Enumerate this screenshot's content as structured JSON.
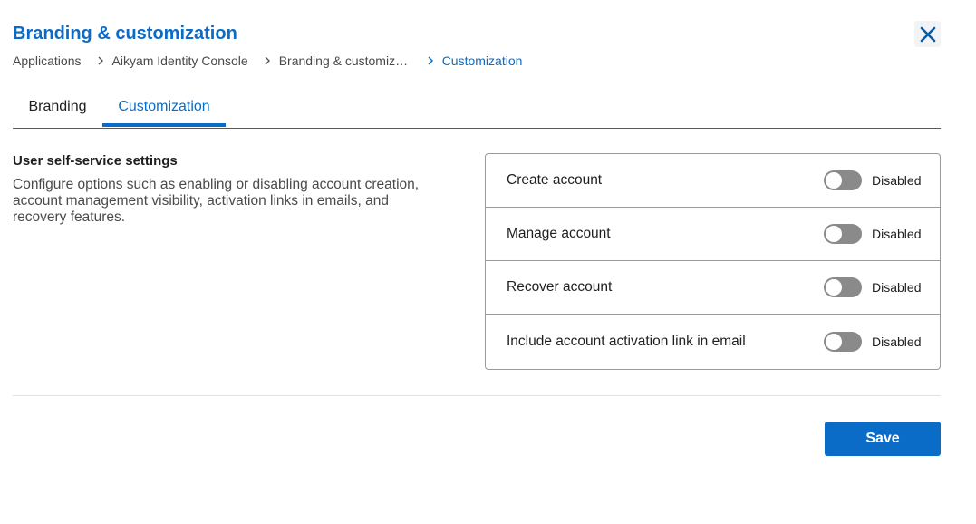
{
  "header": {
    "title": "Branding & customization",
    "close_icon": "close-icon"
  },
  "breadcrumb": [
    "Applications",
    "Aikyam Identity Console",
    "Branding & customiza...",
    "Customization"
  ],
  "tabs": [
    {
      "label": "Branding",
      "active": false
    },
    {
      "label": "Customization",
      "active": true
    }
  ],
  "section": {
    "heading": "User self-service settings",
    "description": "Configure options such as enabling or disabling account creation, account management visibility, activation links in emails, and recovery features."
  },
  "settings": [
    {
      "label": "Create account",
      "status": "Disabled",
      "enabled": false
    },
    {
      "label": "Manage account",
      "status": "Disabled",
      "enabled": false
    },
    {
      "label": "Recover account",
      "status": "Disabled",
      "enabled": false
    },
    {
      "label": "Include account activation link in email",
      "status": "Disabled",
      "enabled": false
    }
  ],
  "footer": {
    "save_label": "Save"
  },
  "colors": {
    "accent": "#0b6cc7",
    "toggle_off": "#8a8a8a",
    "border": "#9a9a9a"
  }
}
